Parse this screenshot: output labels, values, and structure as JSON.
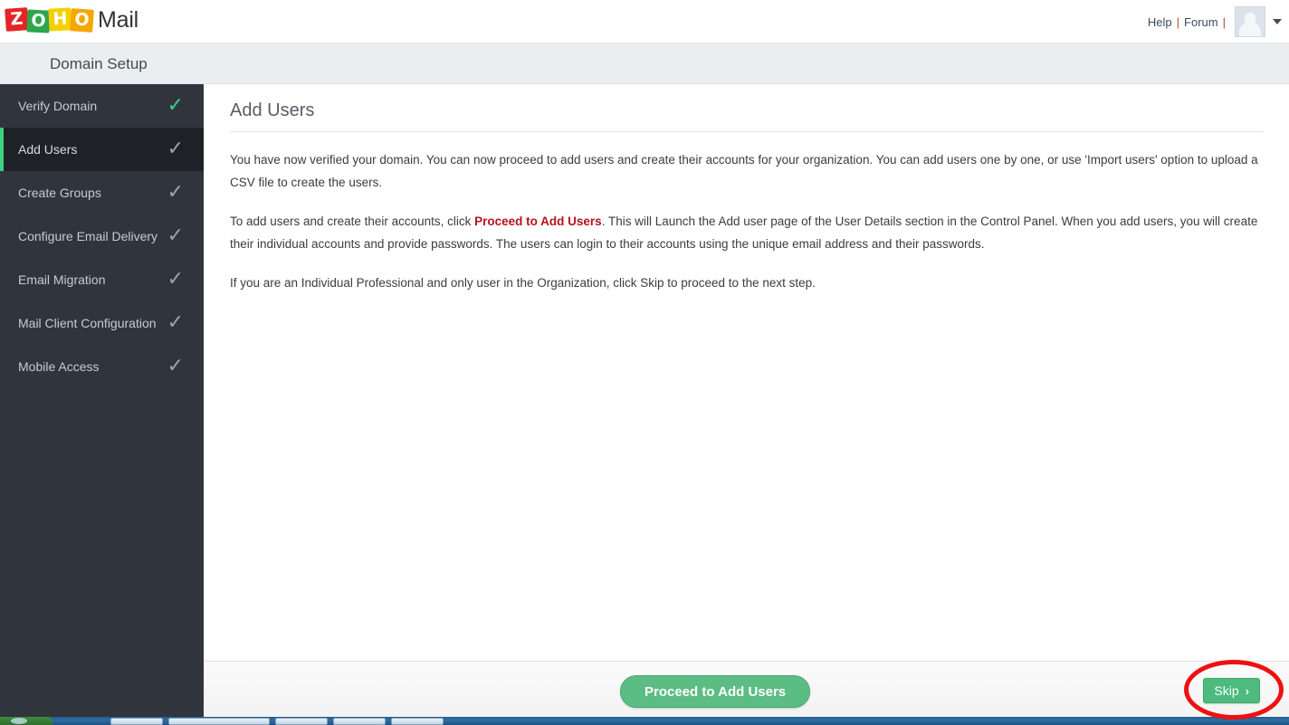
{
  "brand": {
    "logo_tiles": [
      "Z",
      "O",
      "H",
      "O"
    ],
    "logo_word": "Mail",
    "colors": {
      "tile_z": "#e42527",
      "tile_o1": "#2ea74c",
      "tile_h": "#f5d000",
      "tile_o2": "#f5a700",
      "accent_green": "#3dcf82",
      "button_green": "#5cbd84",
      "emphasis_red": "#b7121c",
      "annotation_red": "#ee1111",
      "sidebar_bg": "#30353d",
      "sidebar_active_bg": "#1e2227"
    }
  },
  "topbar": {
    "help_label": "Help",
    "separator": "|",
    "forum_label": "Forum",
    "separator2": "|"
  },
  "section": {
    "title": "Domain Setup"
  },
  "sidebar": {
    "items": [
      {
        "label": "Verify Domain",
        "check": "✓",
        "state": "complete",
        "active": false
      },
      {
        "label": "Add Users",
        "check": "✓",
        "state": "current",
        "active": true
      },
      {
        "label": "Create Groups",
        "check": "✓",
        "state": "pending",
        "active": false
      },
      {
        "label": "Configure Email Delivery",
        "check": "✓",
        "state": "pending",
        "active": false
      },
      {
        "label": "Email Migration",
        "check": "✓",
        "state": "pending",
        "active": false
      },
      {
        "label": "Mail Client Configuration",
        "check": "✓",
        "state": "pending",
        "active": false
      },
      {
        "label": "Mobile Access",
        "check": "✓",
        "state": "pending",
        "active": false
      }
    ]
  },
  "main": {
    "page_title": "Add Users",
    "paragraph_1": "You have now verified your domain. You can now proceed to add users and create their accounts for your organization. You can add users one by one, or use 'Import users' option to upload a CSV file to create the users.",
    "paragraph_2_before": "To add users and create their accounts, click ",
    "paragraph_2_emphasis": "Proceed to Add Users",
    "paragraph_2_after": ". This will Launch the Add user page of the User Details section in the Control Panel. When you add users, you will create their individual accounts and provide passwords. The users can login to their accounts using the unique email address and their passwords.",
    "paragraph_3": "If you are an Individual Professional and only user in the Organization, click Skip to proceed to the next step."
  },
  "footer": {
    "primary_button": "Proceed to Add Users",
    "skip_button": "Skip",
    "skip_chevron": "›"
  }
}
